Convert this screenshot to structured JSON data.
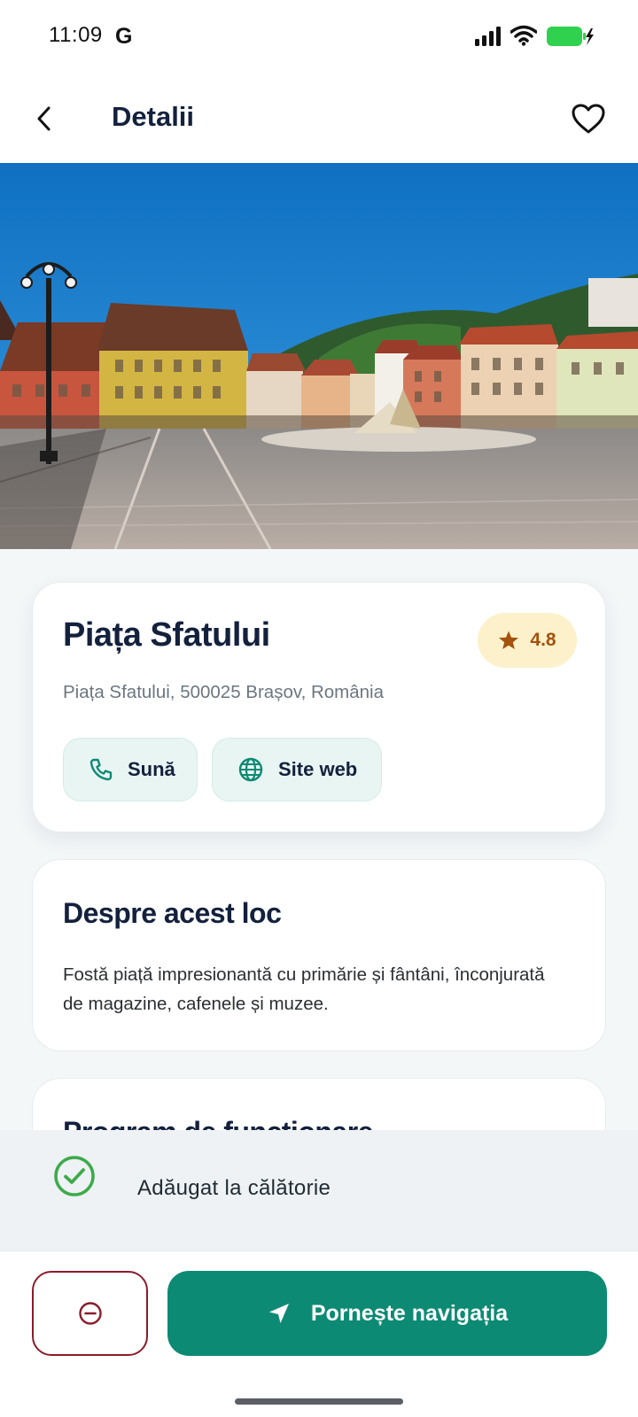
{
  "status_bar": {
    "time": "11:09",
    "app_indicator": "G",
    "icons": [
      "signal-icon",
      "wifi-icon",
      "battery-charging-icon"
    ]
  },
  "header": {
    "title": "Detalii",
    "back_icon": "chevron-left-icon",
    "favorite_icon": "heart-outline-icon"
  },
  "hero": {
    "image": "town-square-photo"
  },
  "place": {
    "name": "Piața Sfatului",
    "rating": "4.8",
    "rating_icon": "star-icon",
    "address": "Piața Sfatului, 500025 Brașov, România",
    "actions": [
      {
        "label": "Sună",
        "icon": "phone-icon"
      },
      {
        "label": "Site web",
        "icon": "globe-icon"
      }
    ]
  },
  "about": {
    "title": "Despre acest loc",
    "text": "Fostă piață impresionantă cu primărie și fântâni, înconjurată de magazine, cafenele și muzee."
  },
  "hours": {
    "title": "Program de funcționare"
  },
  "toast": {
    "text": "Adăugat la călătorie",
    "icon": "check-circle-icon"
  },
  "bottom_bar": {
    "remove_icon": "minus-circle-icon",
    "navigate_label": "Pornește navigația",
    "navigate_icon": "navigation-arrow-icon"
  },
  "colors": {
    "primary": "#0d8a74",
    "title": "#14213d",
    "rating_bg": "#fdf1cc",
    "rating_fg": "#a4520d",
    "chip_bg": "#e9f5f3",
    "danger": "#8a1c2b",
    "success": "#3daa4b"
  }
}
